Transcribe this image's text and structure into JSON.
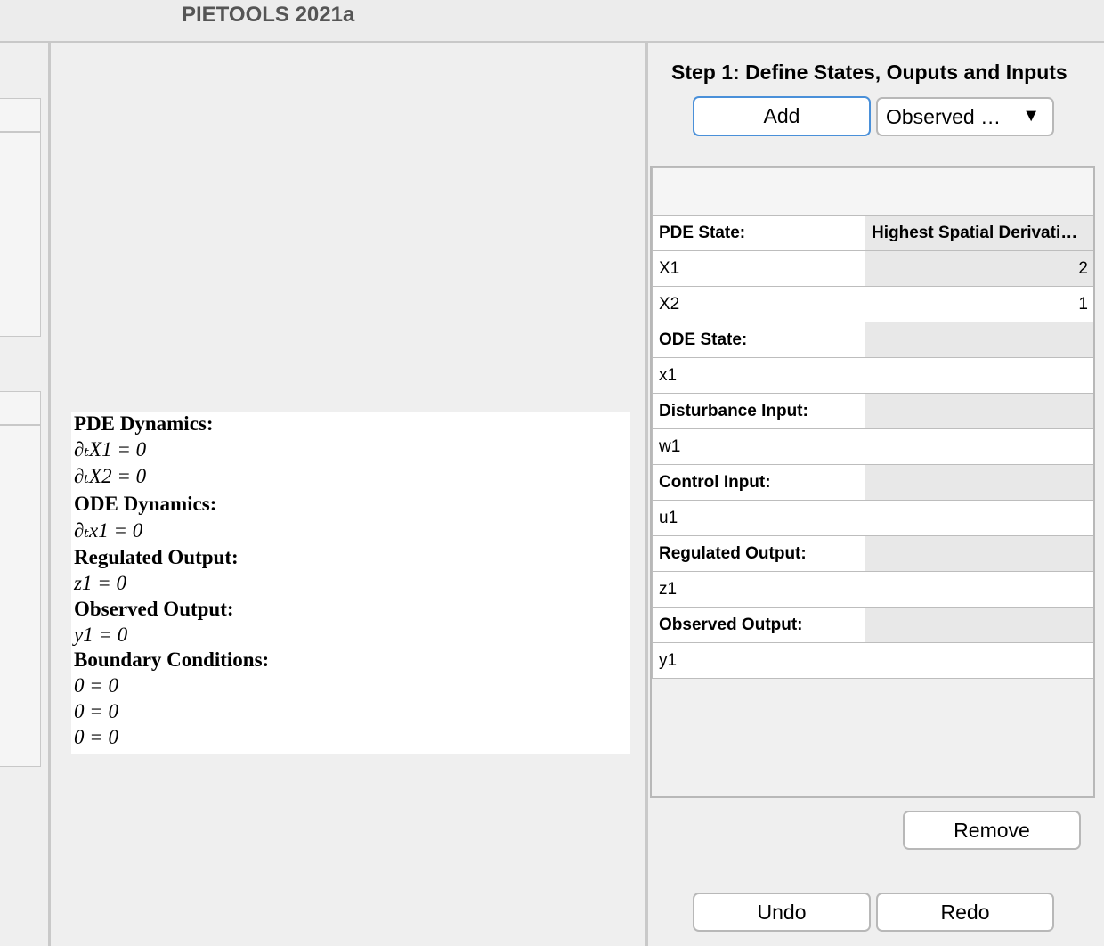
{
  "window": {
    "title": "PIETOOLS 2021a"
  },
  "preview": {
    "lines": [
      {
        "kind": "head",
        "text": "PDE Dynamics:"
      },
      {
        "kind": "eq",
        "text": "∂ₜX1 = 0"
      },
      {
        "kind": "eq",
        "text": "∂ₜX2 = 0"
      },
      {
        "kind": "head",
        "text": "ODE Dynamics:"
      },
      {
        "kind": "eq",
        "text": "∂ₜx1 = 0"
      },
      {
        "kind": "head",
        "text": "Regulated Output:"
      },
      {
        "kind": "eq",
        "text": "z1 = 0"
      },
      {
        "kind": "head",
        "text": "Observed Output:"
      },
      {
        "kind": "eq",
        "text": "y1 = 0"
      },
      {
        "kind": "head",
        "text": "Boundary Conditions:"
      },
      {
        "kind": "eq",
        "text": "0 = 0"
      },
      {
        "kind": "eq",
        "text": "0 = 0"
      },
      {
        "kind": "eq",
        "text": "0 = 0"
      }
    ]
  },
  "step1": {
    "title": "Step 1: Define States, Ouputs and Inputs",
    "add_label": "Add",
    "type_selected": "Observed …",
    "dropdown_arrow": "▼",
    "remove_label": "Remove",
    "undo_label": "Undo",
    "redo_label": "Redo"
  },
  "table": {
    "col2_header": "Highest Spatial Derivati…",
    "rows": [
      {
        "kind": "group",
        "label": "PDE State:",
        "value": "",
        "col2": "Highest Spatial Derivati…"
      },
      {
        "kind": "item",
        "label": "X1",
        "value": "2",
        "alt": true
      },
      {
        "kind": "item",
        "label": "X2",
        "value": "1",
        "alt": false
      },
      {
        "kind": "group",
        "label": "ODE State:",
        "value": ""
      },
      {
        "kind": "item",
        "label": "x1",
        "value": ""
      },
      {
        "kind": "group",
        "label": "Disturbance Input:",
        "value": ""
      },
      {
        "kind": "item",
        "label": "w1",
        "value": ""
      },
      {
        "kind": "group",
        "label": "Control Input:",
        "value": ""
      },
      {
        "kind": "item",
        "label": "u1",
        "value": ""
      },
      {
        "kind": "group",
        "label": "Regulated Output:",
        "value": ""
      },
      {
        "kind": "item",
        "label": "z1",
        "value": ""
      },
      {
        "kind": "group",
        "label": "Observed Output:",
        "value": ""
      },
      {
        "kind": "item",
        "label": "y1",
        "value": ""
      }
    ]
  }
}
